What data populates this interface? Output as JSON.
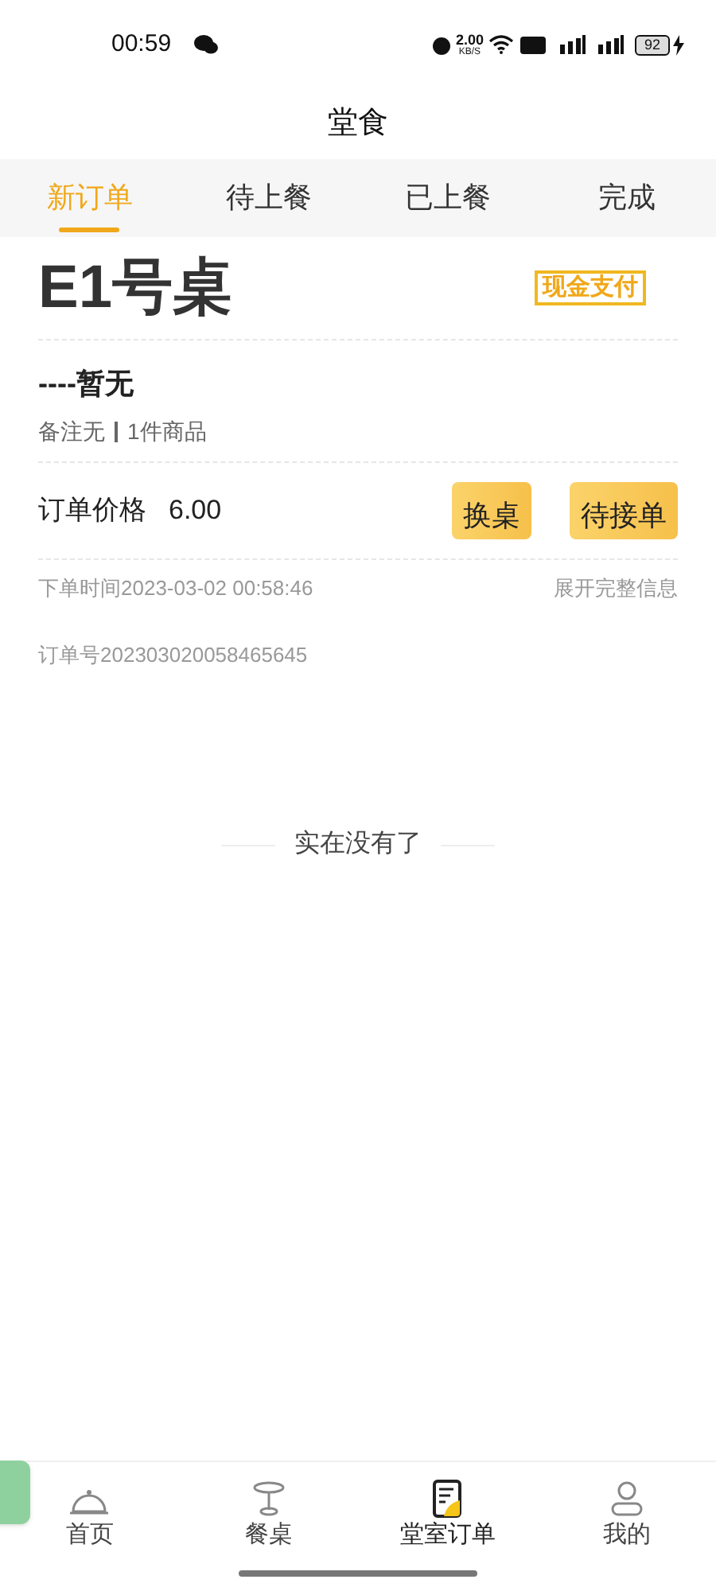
{
  "status_bar": {
    "time": "00:59",
    "speed": "2.00",
    "speed_unit": "KB/S",
    "battery": "92"
  },
  "title": "堂食",
  "tabs": [
    {
      "label": "新订单",
      "selected": true
    },
    {
      "label": "待上餐",
      "selected": false
    },
    {
      "label": "已上餐",
      "selected": false
    },
    {
      "label": "完成",
      "selected": false
    }
  ],
  "order": {
    "table": "E1号桌",
    "payment": "现金支付",
    "customer": "----暂无",
    "note": "备注无",
    "items": "1件商品",
    "price_label": "订单价格",
    "price": "6.00",
    "buttons": [
      "换桌",
      "待接单"
    ],
    "time": "下单时间2023-03-02 00:58:46",
    "expand": "展开完整信息",
    "number": "订单号202303020058465645"
  },
  "end_text": "实在没有了",
  "nav": [
    {
      "label": "首页",
      "kind": "bell",
      "selected": false
    },
    {
      "label": "餐桌",
      "kind": "table",
      "selected": false
    },
    {
      "label": "堂室订单",
      "kind": "order",
      "selected": true
    },
    {
      "label": "我的",
      "kind": "user",
      "selected": false
    }
  ]
}
